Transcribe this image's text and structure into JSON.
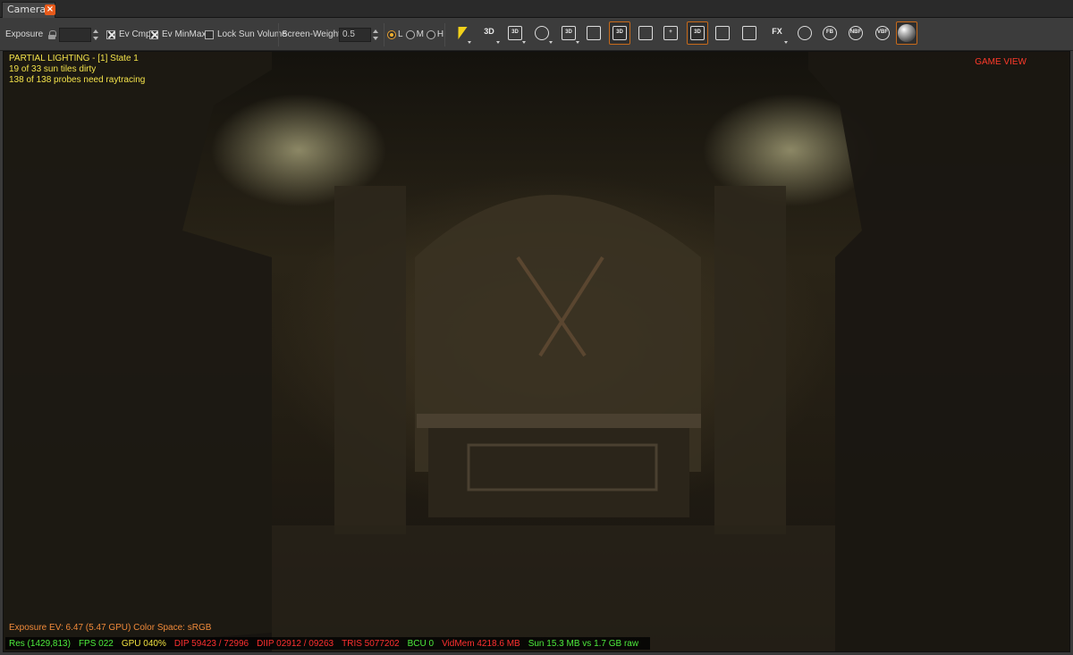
{
  "tab": {
    "label": "Camera",
    "close": "×"
  },
  "toolbar": {
    "exposure_label": "Exposure",
    "exposure_value": "",
    "ev_cmp_label": "Ev Cmp",
    "ev_minmax_label": "Ev MinMax",
    "lock_sun_label": "Lock Sun Volume",
    "screen_weight_label": "Screen-Weight",
    "screen_weight_value": "0.5",
    "quality_options": [
      "L",
      "M",
      "H"
    ],
    "quality_selected": "L",
    "buttons": [
      {
        "id": "camera-3d",
        "text": "3D"
      },
      {
        "id": "view-3d",
        "text": "3D"
      },
      {
        "id": "light",
        "text": ""
      },
      {
        "id": "box-3d",
        "text": "3D"
      },
      {
        "id": "lock-box",
        "text": ""
      },
      {
        "id": "select-3d",
        "text": "3D"
      },
      {
        "id": "select-2d",
        "text": ""
      },
      {
        "id": "add-probe",
        "text": "+"
      },
      {
        "id": "frame-3d",
        "text": "3D"
      },
      {
        "id": "frame",
        "text": ""
      },
      {
        "id": "edit",
        "text": ""
      },
      {
        "id": "fx",
        "text": "FX"
      },
      {
        "id": "grid-sphere",
        "text": ""
      },
      {
        "id": "fb",
        "text": "FB"
      },
      {
        "id": "nbf",
        "text": "NBF"
      },
      {
        "id": "vbf",
        "text": "VBF"
      },
      {
        "id": "material-sphere",
        "text": ""
      }
    ],
    "colors": {
      "accent": "#c76a1b",
      "bolt": "#f3d21a"
    }
  },
  "viewport": {
    "hud_top_left": [
      "PARTIAL LIGHTING - [1] State 1",
      "19 of 33 sun tiles dirty",
      "138 of 138 probes need raytracing"
    ],
    "hud_top_right": "GAME VIEW",
    "exposure_line": "Exposure EV: 6.47 (5.47 GPU)   Color Space: sRGB",
    "status": {
      "res": "Res (1429,813)",
      "fps": "FPS 022",
      "gpu": "GPU 040%",
      "dip": "DIP 59423 / 72996",
      "diip": "DIIP 02912 / 09263",
      "tris": "TRIS 5077202",
      "bcu": "BCU 0",
      "vidmem": "VidMem 4218.6 MB",
      "sun": "Sun 15.3 MB vs 1.7 GB raw"
    }
  }
}
